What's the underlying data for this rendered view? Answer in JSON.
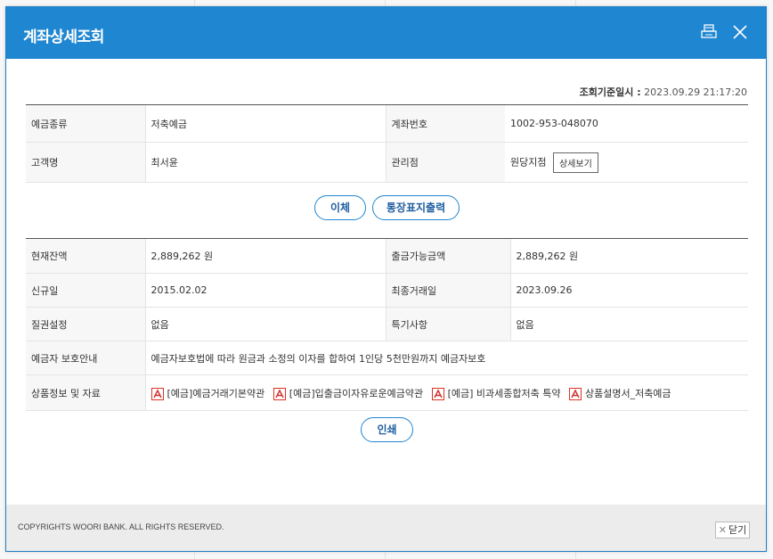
{
  "window": {
    "title": "계좌상세조회"
  },
  "header": {
    "print_icon": "printer-icon",
    "close_icon": "close-icon"
  },
  "timestamp": {
    "label": "조회기준일시 :",
    "value": "2023.09.29 21:17:20"
  },
  "account": {
    "type_label": "예금종류",
    "type_value": "저축예금",
    "number_label": "계좌번호",
    "number_value": "1002-953-048070",
    "customer_label": "고객명",
    "customer_value": "최서윤",
    "branch_label": "관리점",
    "branch_value": "원당지점",
    "detail_button": "상세보기"
  },
  "actions": {
    "transfer": "이체",
    "passbook": "통장표지출력"
  },
  "details": {
    "balance_label": "현재잔액",
    "balance_value": "2,889,262 원",
    "withdrawable_label": "출금가능금액",
    "withdrawable_value": "2,889,262 원",
    "opened_label": "신규일",
    "opened_value": "2015.02.02",
    "last_tx_label": "최종거래일",
    "last_tx_value": "2023.09.26",
    "pledge_label": "질권설정",
    "pledge_value": "없음",
    "special_label": "특기사항",
    "special_value": "없음",
    "protection_label": "예금자 보호안내",
    "protection_value": "예금자보호법에 따라 원금과 소정의 이자를 합하여 1인당 5천만원까지 예금자보호",
    "docs_label": "상품정보 및 자료",
    "docs": [
      "[예금]예금거래기본약관",
      "[예금]입출금이자유로운예금약관",
      "[예금] 비과세종합저축 특약",
      "상품설명서_저축예금"
    ]
  },
  "print_button": "인쇄",
  "footer": {
    "copyright": "COPYRIGHTS WOORI BANK. ALL RIGHTS RESERVED.",
    "close_label": "닫기"
  },
  "colors": {
    "header": "#1f86d1",
    "accent": "#1f5fa0",
    "pdf": "#d32f2f"
  }
}
